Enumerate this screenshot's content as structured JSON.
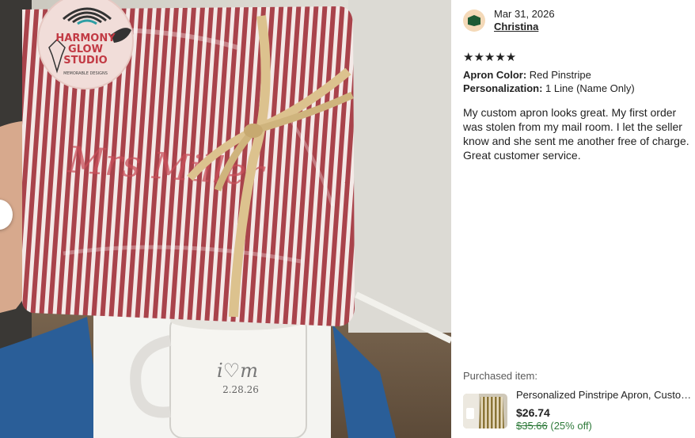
{
  "photo": {
    "logo_lines": [
      "HARMONY",
      "GLOW",
      "STUDIO"
    ],
    "logo_tagline": "MEMORABLE DESIGNS",
    "mug_monogram": "i♡m",
    "mug_date": "2.28.26"
  },
  "review": {
    "date": "Mar 31, 2026",
    "reviewer": "Christina",
    "stars": "★★★★★",
    "details": [
      {
        "key": "Apron Color:",
        "value": " Red Pinstripe"
      },
      {
        "key": "Personalization:",
        "value": " 1 Line (Name Only)"
      }
    ],
    "text": "My custom apron looks great. My first order was stolen from my mail room. I let the seller know and she sent me another free of charge. Great customer service."
  },
  "purchased": {
    "label": "Purchased item:",
    "title": "Personalized Pinstripe Apron, Custom Apron...",
    "price": "$26.74",
    "original_price": "$35.66",
    "discount": " (25% off)"
  },
  "colors": {
    "stripe_red": "#9e2a33",
    "ribbon": "#dcc28e",
    "avatar_bg": "#f4d9b8",
    "avatar_shape": "#1c5a34",
    "discount_green": "#2e7a3a"
  }
}
